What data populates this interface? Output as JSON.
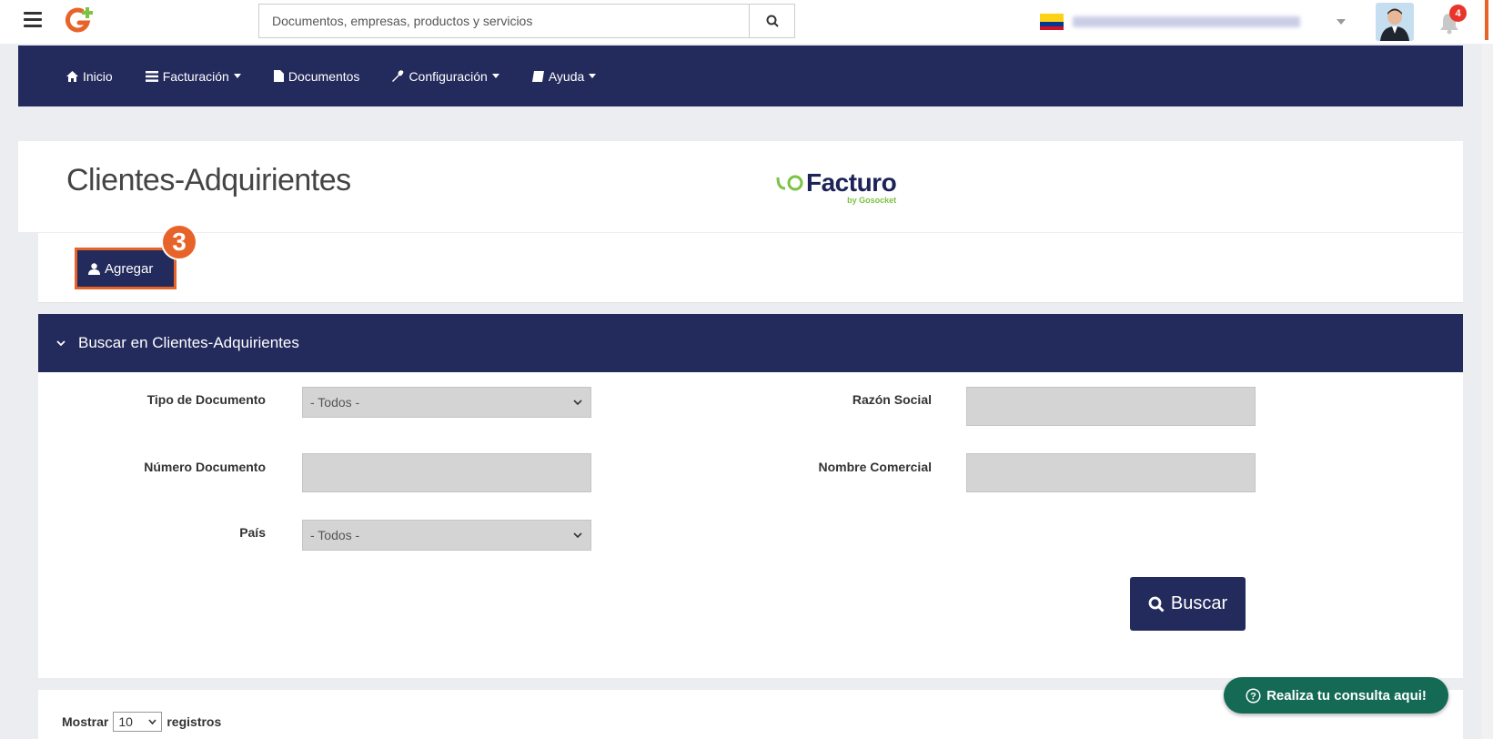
{
  "topbar": {
    "search_placeholder": "Documentos, empresas, productos y servicios",
    "notification_count": "4"
  },
  "nav": {
    "items": [
      {
        "label": "Inicio",
        "icon": "home-icon",
        "dropdown": false
      },
      {
        "label": "Facturación",
        "icon": "list-icon",
        "dropdown": true
      },
      {
        "label": "Documentos",
        "icon": "file-icon",
        "dropdown": false
      },
      {
        "label": "Configuración",
        "icon": "wrench-icon",
        "dropdown": true
      },
      {
        "label": "Ayuda",
        "icon": "book-icon",
        "dropdown": true
      }
    ]
  },
  "page": {
    "title": "Clientes-Adquirientes",
    "brand_name": "Facturo",
    "brand_sub": "by Gosocket"
  },
  "toolbar": {
    "add_label": "Agregar",
    "step_number": "3"
  },
  "search_panel": {
    "title": "Buscar en Clientes-Adquirientes",
    "fields": {
      "tipo_documento_label": "Tipo de Documento",
      "tipo_documento_value": "- Todos -",
      "numero_documento_label": "Número Documento",
      "pais_label": "País",
      "pais_value": "- Todos -",
      "razon_social_label": "Razón Social",
      "nombre_comercial_label": "Nombre Comercial"
    },
    "search_label": "Buscar"
  },
  "table_controls": {
    "show_label": "Mostrar",
    "show_value": "10",
    "records_label": "registros"
  },
  "help": {
    "label": "Realiza tu consulta aqui!"
  },
  "colors": {
    "navy": "#232a5c",
    "accent_orange": "#e8632a",
    "help_green": "#146a54",
    "brand_green": "#7cc243"
  }
}
